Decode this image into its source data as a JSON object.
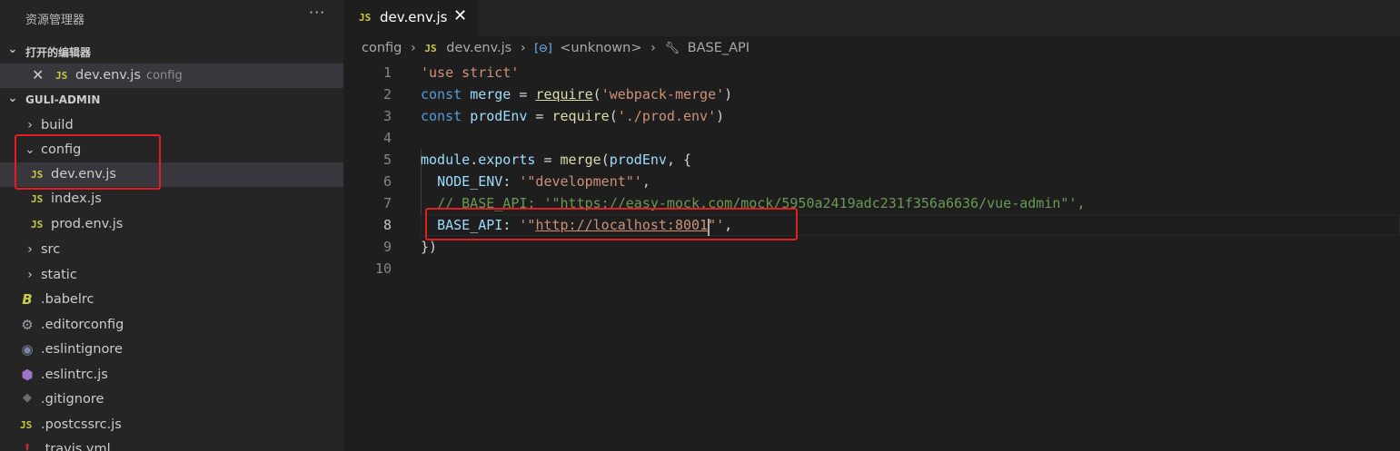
{
  "sidebar": {
    "title": "资源管理器",
    "more_icon": "ellipsis-icon",
    "open_editors_header": "打开的编辑器",
    "open_editors": [
      {
        "label": "dev.env.js",
        "desc": "config",
        "icon": "JS"
      }
    ],
    "project_header": "GULI-ADMIN",
    "tree": [
      {
        "label": "build",
        "type": "folder",
        "expanded": false
      },
      {
        "label": "config",
        "type": "folder",
        "expanded": true
      },
      {
        "label": "dev.env.js",
        "type": "js",
        "icon": "JS"
      },
      {
        "label": "index.js",
        "type": "js",
        "icon": "JS"
      },
      {
        "label": "prod.env.js",
        "type": "js",
        "icon": "JS"
      },
      {
        "label": "src",
        "type": "folder",
        "expanded": false
      },
      {
        "label": "static",
        "type": "folder",
        "expanded": false
      },
      {
        "label": ".babelrc",
        "type": "babel"
      },
      {
        "label": ".editorconfig",
        "type": "gear"
      },
      {
        "label": ".eslintignore",
        "type": "circle"
      },
      {
        "label": ".eslintrc.js",
        "type": "eslint"
      },
      {
        "label": ".gitignore",
        "type": "git"
      },
      {
        "label": ".postcssrc.js",
        "type": "js",
        "icon": "JS"
      },
      {
        "label": ".travis.yml",
        "type": "yml"
      }
    ]
  },
  "tab": {
    "label": "dev.env.js",
    "icon": "JS",
    "close": "✕"
  },
  "breadcrumb": {
    "folder": "config",
    "file": "dev.env.js",
    "file_icon": "JS",
    "symbol": "<unknown>",
    "property": "BASE_API"
  },
  "editor": {
    "current_line": 8,
    "line_numbers": [
      "1",
      "2",
      "3",
      "4",
      "5",
      "6",
      "7",
      "8",
      "9",
      "10"
    ],
    "lines": [
      [
        {
          "t": "'use strict'",
          "c": "str"
        }
      ],
      [
        {
          "t": "const ",
          "c": "kw"
        },
        {
          "t": "merge",
          "c": "var"
        },
        {
          "t": " = ",
          "c": "op"
        },
        {
          "t": "require",
          "c": "fn ul"
        },
        {
          "t": "(",
          "c": "op"
        },
        {
          "t": "'webpack-merge'",
          "c": "str"
        },
        {
          "t": ")",
          "c": "op"
        }
      ],
      [
        {
          "t": "const ",
          "c": "kw"
        },
        {
          "t": "prodEnv",
          "c": "var"
        },
        {
          "t": " = ",
          "c": "op"
        },
        {
          "t": "require",
          "c": "fn"
        },
        {
          "t": "(",
          "c": "op"
        },
        {
          "t": "'./prod.env'",
          "c": "str"
        },
        {
          "t": ")",
          "c": "op"
        }
      ],
      [],
      [
        {
          "t": "module",
          "c": "var"
        },
        {
          "t": ".",
          "c": "op"
        },
        {
          "t": "exports",
          "c": "var"
        },
        {
          "t": " = ",
          "c": "op"
        },
        {
          "t": "merge",
          "c": "fn"
        },
        {
          "t": "(",
          "c": "op"
        },
        {
          "t": "prodEnv",
          "c": "var"
        },
        {
          "t": ", {",
          "c": "op"
        }
      ],
      [
        {
          "t": "  ",
          "c": "op"
        },
        {
          "t": "NODE_ENV",
          "c": "var"
        },
        {
          "t": ": ",
          "c": "op"
        },
        {
          "t": "'\"development\"'",
          "c": "str"
        },
        {
          "t": ",",
          "c": "op"
        }
      ],
      [
        {
          "t": "  ",
          "c": "op"
        },
        {
          "t": "// BASE_API: '\"https://easy-mock.com/mock/5950a2419adc231f356a6636/vue-admin\"',",
          "c": "cmt"
        }
      ],
      [
        {
          "t": "  ",
          "c": "op"
        },
        {
          "t": "BASE_API",
          "c": "var"
        },
        {
          "t": ": ",
          "c": "op"
        },
        {
          "t": "'\"",
          "c": "str"
        },
        {
          "t": "http://localhost:8001",
          "c": "str ul"
        },
        {
          "t": "\"'",
          "c": "str"
        },
        {
          "t": ",",
          "c": "op"
        }
      ],
      [
        {
          "t": "})",
          "c": "op"
        }
      ],
      []
    ]
  }
}
